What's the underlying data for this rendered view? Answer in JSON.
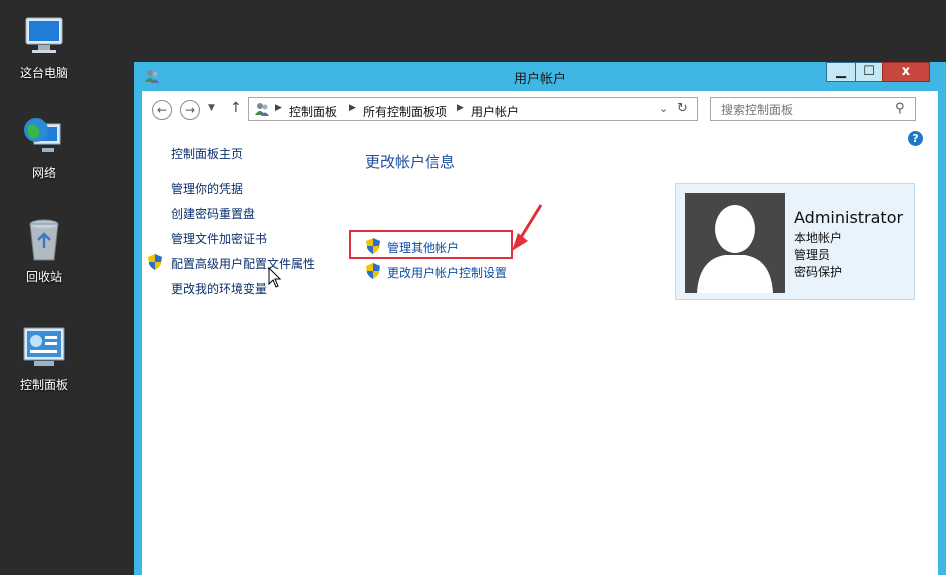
{
  "desktop": {
    "icons": [
      {
        "label": "这台电脑",
        "icon": "computer-icon"
      },
      {
        "label": "网络",
        "icon": "network-globe-icon"
      },
      {
        "label": "回收站",
        "icon": "recycle-bin-icon"
      },
      {
        "label": "控制面板",
        "icon": "control-panel-icon"
      }
    ]
  },
  "window": {
    "title": "用户帐户",
    "controls": {
      "minimize": "▁",
      "maximize": "☐",
      "close": "x"
    },
    "address": {
      "crumbs": [
        "控制面板",
        "所有控制面板项",
        "用户帐户"
      ]
    },
    "search": {
      "placeholder": "搜索控制面板"
    },
    "left_nav": {
      "items": [
        "控制面板主页",
        "管理你的凭据",
        "创建密码重置盘",
        "管理文件加密证书",
        "配置高级用户配置文件属性",
        "更改我的环境变量"
      ]
    },
    "main": {
      "heading": "更改帐户信息",
      "tasks": [
        "管理其他帐户",
        "更改用户帐户控制设置"
      ]
    },
    "account": {
      "name": "Administrator",
      "type": "本地帐户",
      "role": "管理员",
      "protection": "密码保护"
    },
    "help_label": "?"
  },
  "colors": {
    "window_frame": "#3fb6e4",
    "link": "#0b4fa8",
    "heading": "#1e4fa0",
    "highlight_box": "#e0313a",
    "close_button": "#c7463d"
  }
}
